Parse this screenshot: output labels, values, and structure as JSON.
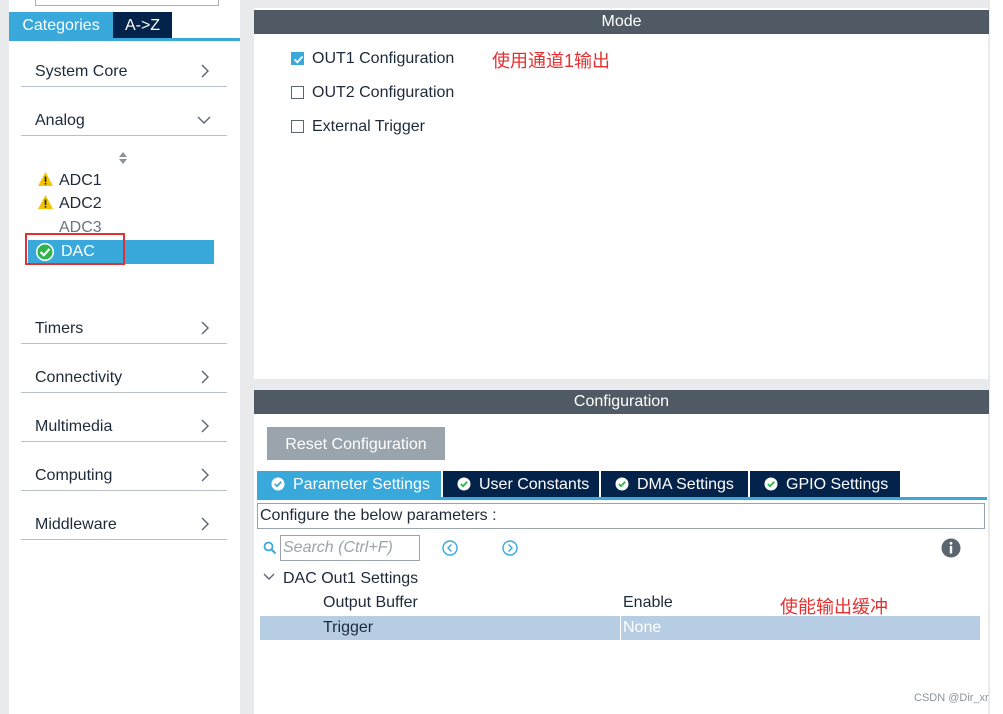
{
  "sidebar": {
    "tabs": [
      {
        "label": "Categories",
        "active": true
      },
      {
        "label": "A->Z",
        "active": false
      }
    ],
    "categories": [
      {
        "label": "System Core",
        "expanded": false
      },
      {
        "label": "Analog",
        "expanded": true
      },
      {
        "label": "Timers",
        "expanded": false
      },
      {
        "label": "Connectivity",
        "expanded": false
      },
      {
        "label": "Multimedia",
        "expanded": false
      },
      {
        "label": "Computing",
        "expanded": false
      },
      {
        "label": "Middleware",
        "expanded": false
      }
    ],
    "analog_items": [
      {
        "label": "ADC1",
        "status": "warning"
      },
      {
        "label": "ADC2",
        "status": "warning"
      },
      {
        "label": "ADC3",
        "status": "none"
      },
      {
        "label": "DAC",
        "status": "ok",
        "selected": true
      }
    ]
  },
  "mode": {
    "header": "Mode",
    "options": [
      {
        "label": "OUT1 Configuration",
        "checked": true
      },
      {
        "label": "OUT2 Configuration",
        "checked": false
      },
      {
        "label": "External Trigger",
        "checked": false
      }
    ],
    "annotation": "使用通道1输出"
  },
  "configuration": {
    "header": "Configuration",
    "reset_label": "Reset Configuration",
    "tabs": [
      {
        "label": "Parameter Settings",
        "active": true
      },
      {
        "label": "User Constants",
        "active": false
      },
      {
        "label": "DMA Settings",
        "active": false
      },
      {
        "label": "GPIO Settings",
        "active": false
      }
    ],
    "description": "Configure the below parameters :",
    "search_placeholder": "Search (Ctrl+F)",
    "group": "DAC Out1 Settings",
    "params": [
      {
        "name": "Output Buffer",
        "value": "Enable"
      },
      {
        "name": "Trigger",
        "value": "None"
      }
    ],
    "annotation": "使能输出缓冲"
  },
  "watermark": "CSDN @Dir_xr",
  "colors": {
    "accent": "#39a9dc",
    "navy": "#03234b",
    "header_gray": "#505a64",
    "annotation_red": "#e33030",
    "warning_yellow": "#f5c400"
  }
}
